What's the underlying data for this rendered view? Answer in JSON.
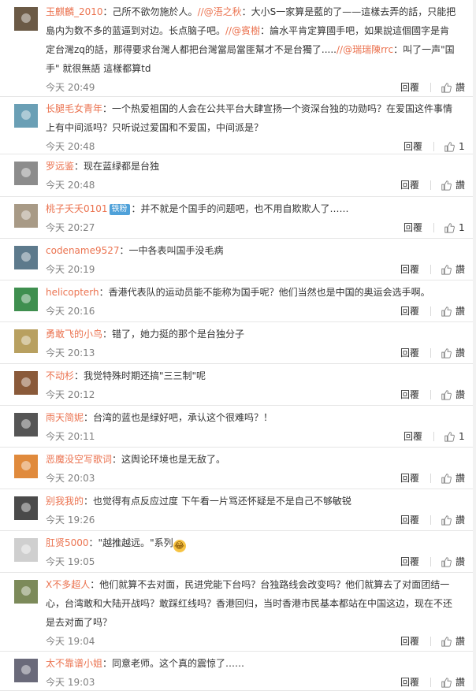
{
  "labels": {
    "reply": "回覆",
    "like_empty": "讚"
  },
  "colors": {
    "username": "#eb7350",
    "time": "#808080",
    "text": "#333333",
    "badge": "#4fa1d9"
  },
  "comments": [
    {
      "username": "玉麒麟_2010",
      "text": "：己所不欲勿施於人。",
      "mention1": "//@浯之秋",
      "text2": "：大小S一家算是藍的了——這樣去弄的話，只能把島内为数不多的蓝逼到对边。长点脑子吧。",
      "mention2": "//@賓樹",
      "text3": "：論水平肯定算國手吧，如果說這個國字是肯定台灣zq的話，那得要求台灣人都把台灣當局當匪幫才不是台獨了.....",
      "mention3": "//@瑞瑞陳rrc",
      "text4": "：叫了一声\"国手\" 就很無語 這樣都算td",
      "time": "今天 20:49",
      "likes": "",
      "avatar_color": "#6b5a46"
    },
    {
      "username": "长腿毛女青年",
      "text": "：一个热爱祖国的人会在公共平台大肆宣扬一个资深台独的功勋吗？在爱国这件事情上有中间派吗？只听说过爱国和不爱国，中间派是？",
      "time": "今天 20:48",
      "likes": "1",
      "avatar_color": "#6a9fb5"
    },
    {
      "username": "罗远鉴",
      "text": "：现在蓝绿都是台独",
      "time": "今天 20:48",
      "likes": "",
      "avatar_color": "#8c8c8c"
    },
    {
      "username": "桃子夭夭0101",
      "badge": "铁粉",
      "text": "：并不就是个国手的问题吧，也不用自欺欺人了……",
      "time": "今天 20:27",
      "likes": "1",
      "avatar_color": "#a89a86"
    },
    {
      "username": "codename9527",
      "text": "：一中各表叫国手没毛病",
      "time": "今天 20:19",
      "likes": "",
      "avatar_color": "#5d7a8c"
    },
    {
      "username": "helicopterh",
      "text": "：香港代表队的运动员能不能称为国手呢？他们当然也是中国的奥运会选手啊。",
      "time": "今天 20:16",
      "likes": "",
      "avatar_color": "#3f8f4f"
    },
    {
      "username": "勇敢飞的小鸟",
      "text": "：错了，她力挺的那个是台独分子",
      "time": "今天 20:13",
      "likes": "",
      "avatar_color": "#b8a060"
    },
    {
      "username": "不动杉",
      "text": "：我觉特殊时期还搞\"三三制\"呢",
      "time": "今天 20:12",
      "likes": "",
      "avatar_color": "#8a5a3a"
    },
    {
      "username": "雨天简妮",
      "text": "：台湾的蓝也是绿好吧，承认这个很难吗？！",
      "time": "今天 20:11",
      "likes": "1",
      "avatar_color": "#555555"
    },
    {
      "username": "恶魔没空写歌词",
      "text": "：这舆论环境也是无敌了。",
      "time": "今天 20:03",
      "likes": "",
      "avatar_color": "#e08a3c"
    },
    {
      "username": "别我我的",
      "text": "：也觉得有点反应过度 下午看一片骂还怀疑是不是自己不够敏锐",
      "time": "今天 19:26",
      "likes": "",
      "avatar_color": "#4a4a4a"
    },
    {
      "username": "肛贤5000",
      "text": "：\"越推越远。\"系列",
      "emoji": "😂",
      "time": "今天 19:05",
      "likes": "",
      "avatar_color": "#cfcfcf"
    },
    {
      "username": "X不多超人",
      "text": "：他们就算不去对面，民进党能下台吗？台独路线会改变吗？他们就算去了对面团结一心，台湾敢和大陆开战吗？敢踩红线吗？香港回归，当时香港市民基本都站在中国这边，现在不还是去对面了吗？",
      "time": "今天 19:04",
      "likes": "",
      "avatar_color": "#7c8a5a"
    },
    {
      "username": "太不靠谱小姐",
      "text": "：同意老师。这个真的震惊了……",
      "time": "今天 19:03",
      "likes": "",
      "avatar_color": "#6a6a7a"
    }
  ]
}
